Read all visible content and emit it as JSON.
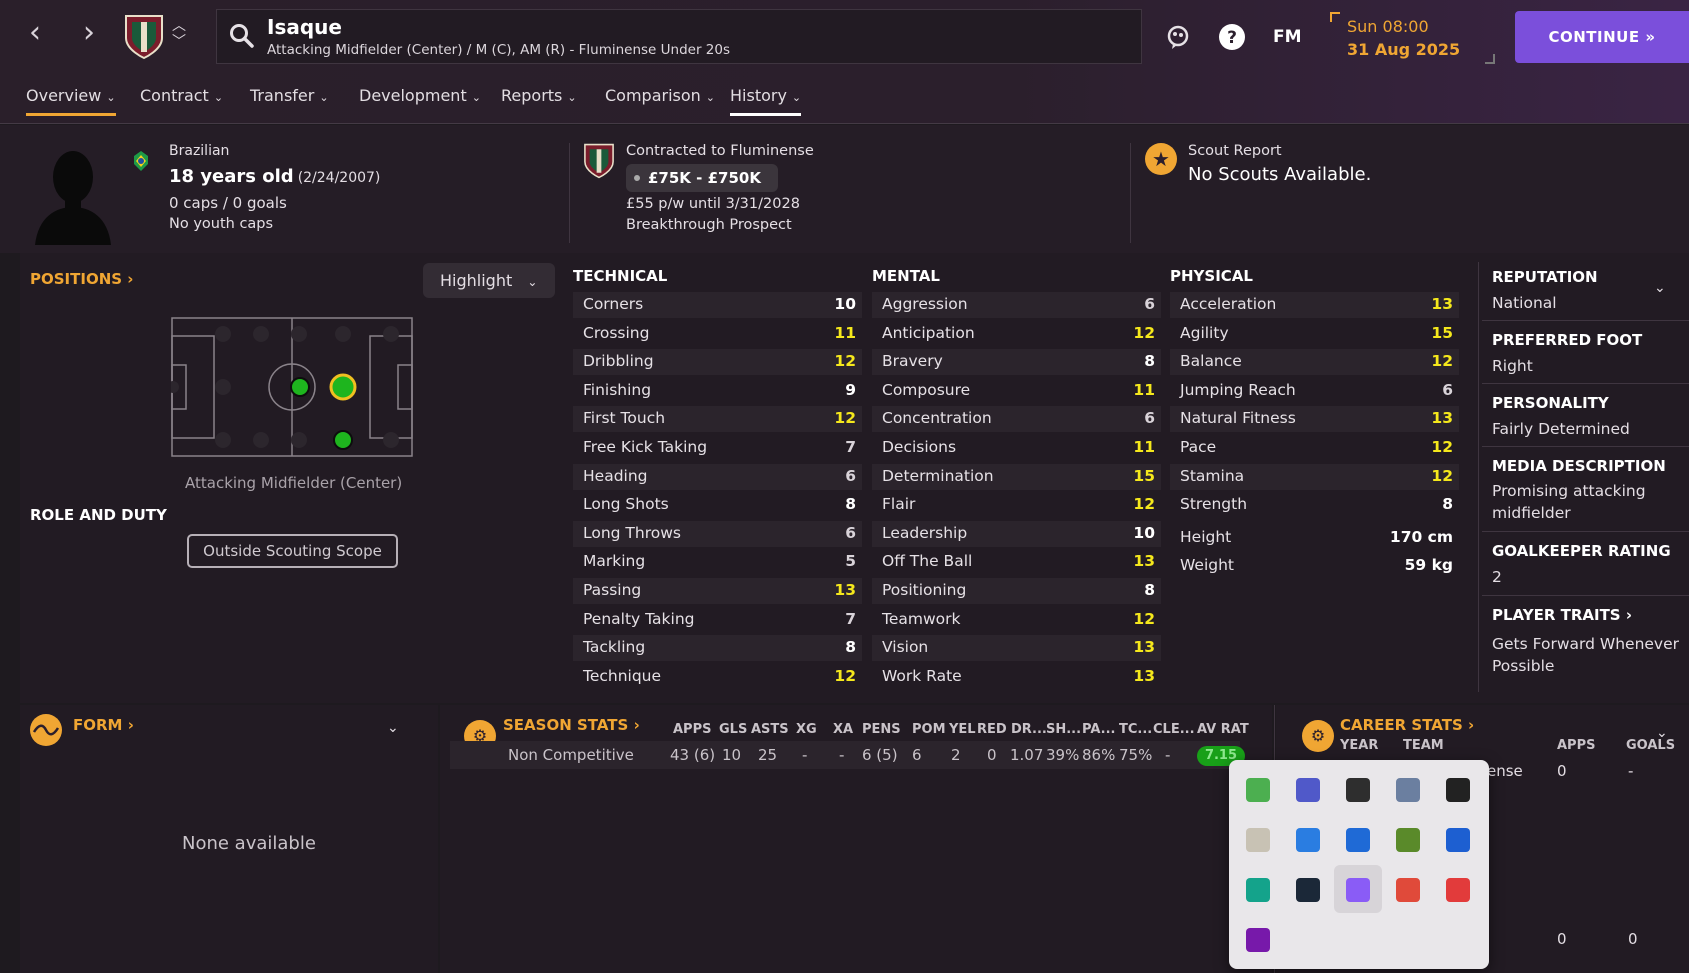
{
  "topbar": {
    "player_name": "Isaque",
    "player_subtitle": "Attacking Midfielder (Center) / M (C), AM (R) - Fluminense Under 20s",
    "fm_label": "FM",
    "date_time": "Sun 08:00",
    "date": "31 Aug 2025",
    "continue_label": "CONTINUE"
  },
  "tabs": [
    {
      "label": "Overview"
    },
    {
      "label": "Contract"
    },
    {
      "label": "Transfer"
    },
    {
      "label": "Development"
    },
    {
      "label": "Reports"
    },
    {
      "label": "Comparison"
    },
    {
      "label": "History"
    }
  ],
  "bio": {
    "nationality": "Brazilian",
    "age": "18 years old",
    "dob": "(2/24/2007)",
    "caps": "0 caps / 0 goals",
    "youth_caps": "No youth caps"
  },
  "contract": {
    "title": "Contracted to Fluminense",
    "value": "£75K - £750K",
    "wage": "£55 p/w until 3/31/2028",
    "status": "Breakthrough Prospect"
  },
  "scout": {
    "title": "Scout Report",
    "value": "No Scouts Available."
  },
  "positions": {
    "title": "POSITIONS",
    "highlight_label": "Highlight",
    "position_label": "Attacking Midfielder (Center)",
    "role_title": "ROLE AND DUTY",
    "scope_button": "Outside Scouting Scope"
  },
  "technical": {
    "title": "TECHNICAL",
    "items": [
      {
        "name": "Corners",
        "value": "10"
      },
      {
        "name": "Crossing",
        "value": "11"
      },
      {
        "name": "Dribbling",
        "value": "12"
      },
      {
        "name": "Finishing",
        "value": "9"
      },
      {
        "name": "First Touch",
        "value": "12"
      },
      {
        "name": "Free Kick Taking",
        "value": "7"
      },
      {
        "name": "Heading",
        "value": "6"
      },
      {
        "name": "Long Shots",
        "value": "8"
      },
      {
        "name": "Long Throws",
        "value": "6"
      },
      {
        "name": "Marking",
        "value": "5"
      },
      {
        "name": "Passing",
        "value": "13"
      },
      {
        "name": "Penalty Taking",
        "value": "7"
      },
      {
        "name": "Tackling",
        "value": "8"
      },
      {
        "name": "Technique",
        "value": "12"
      }
    ]
  },
  "mental": {
    "title": "MENTAL",
    "items": [
      {
        "name": "Aggression",
        "value": "6"
      },
      {
        "name": "Anticipation",
        "value": "12"
      },
      {
        "name": "Bravery",
        "value": "8"
      },
      {
        "name": "Composure",
        "value": "11"
      },
      {
        "name": "Concentration",
        "value": "6"
      },
      {
        "name": "Decisions",
        "value": "11"
      },
      {
        "name": "Determination",
        "value": "15"
      },
      {
        "name": "Flair",
        "value": "12"
      },
      {
        "name": "Leadership",
        "value": "10"
      },
      {
        "name": "Off The Ball",
        "value": "13"
      },
      {
        "name": "Positioning",
        "value": "8"
      },
      {
        "name": "Teamwork",
        "value": "12"
      },
      {
        "name": "Vision",
        "value": "13"
      },
      {
        "name": "Work Rate",
        "value": "13"
      }
    ]
  },
  "physical": {
    "title": "PHYSICAL",
    "items": [
      {
        "name": "Acceleration",
        "value": "13"
      },
      {
        "name": "Agility",
        "value": "15"
      },
      {
        "name": "Balance",
        "value": "12"
      },
      {
        "name": "Jumping Reach",
        "value": "6"
      },
      {
        "name": "Natural Fitness",
        "value": "13"
      },
      {
        "name": "Pace",
        "value": "12"
      },
      {
        "name": "Stamina",
        "value": "12"
      },
      {
        "name": "Strength",
        "value": "8"
      }
    ],
    "height_label": "Height",
    "height": "170 cm",
    "weight_label": "Weight",
    "weight": "59 kg"
  },
  "side": {
    "reputation_title": "REPUTATION",
    "reputation": "National",
    "foot_title": "PREFERRED FOOT",
    "foot": "Right",
    "personality_title": "PERSONALITY",
    "personality": "Fairly Determined",
    "media_title": "MEDIA DESCRIPTION",
    "media": "Promising attacking midfielder",
    "gk_title": "GOALKEEPER RATING",
    "gk": "2",
    "traits_title": "PLAYER TRAITS",
    "traits": "Gets Forward Whenever Possible"
  },
  "form": {
    "title": "FORM",
    "empty": "None available"
  },
  "season_stats": {
    "title": "SEASON STATS",
    "headers": [
      "APPS",
      "GLS",
      "ASTS",
      "XG",
      "XA",
      "PENS",
      "POM",
      "YEL",
      "RED",
      "DR...",
      "SH...",
      "PA...",
      "TC...",
      "CLE...",
      "AV RAT"
    ],
    "row_label": "Non Competitive",
    "row": [
      "43 (6)",
      "10",
      "25",
      "-",
      "-",
      "6 (5)",
      "6",
      "2",
      "0",
      "1.07",
      "39%",
      "86%",
      "75%",
      "-"
    ],
    "av_rat": "7.15"
  },
  "career_stats": {
    "title": "CAREER STATS",
    "headers": [
      "YEAR",
      "TEAM",
      "APPS",
      "GOALS"
    ],
    "row1_team": "ense",
    "row1_apps": "0",
    "row1_goals": "-",
    "total_apps": "0",
    "total_goals": "0"
  },
  "colors": {
    "accent": "#f0a633",
    "continue": "#7b4fdb",
    "high_attr": "#f5e81c",
    "rating_green": "#18a018"
  },
  "tray_icons": [
    "layers-app-icon",
    "teams-icon",
    "nvidia-icon",
    "globe-app-icon",
    "epic-games-icon",
    "disc-app-icon",
    "lightning-app-icon",
    "bluetooth-icon",
    "grid-app-icon",
    "security-warning-icon",
    "green-app-icon",
    "steam-icon",
    "pen-app-icon",
    "pdf-icon",
    "red-app-icon",
    "onenote-icon"
  ]
}
